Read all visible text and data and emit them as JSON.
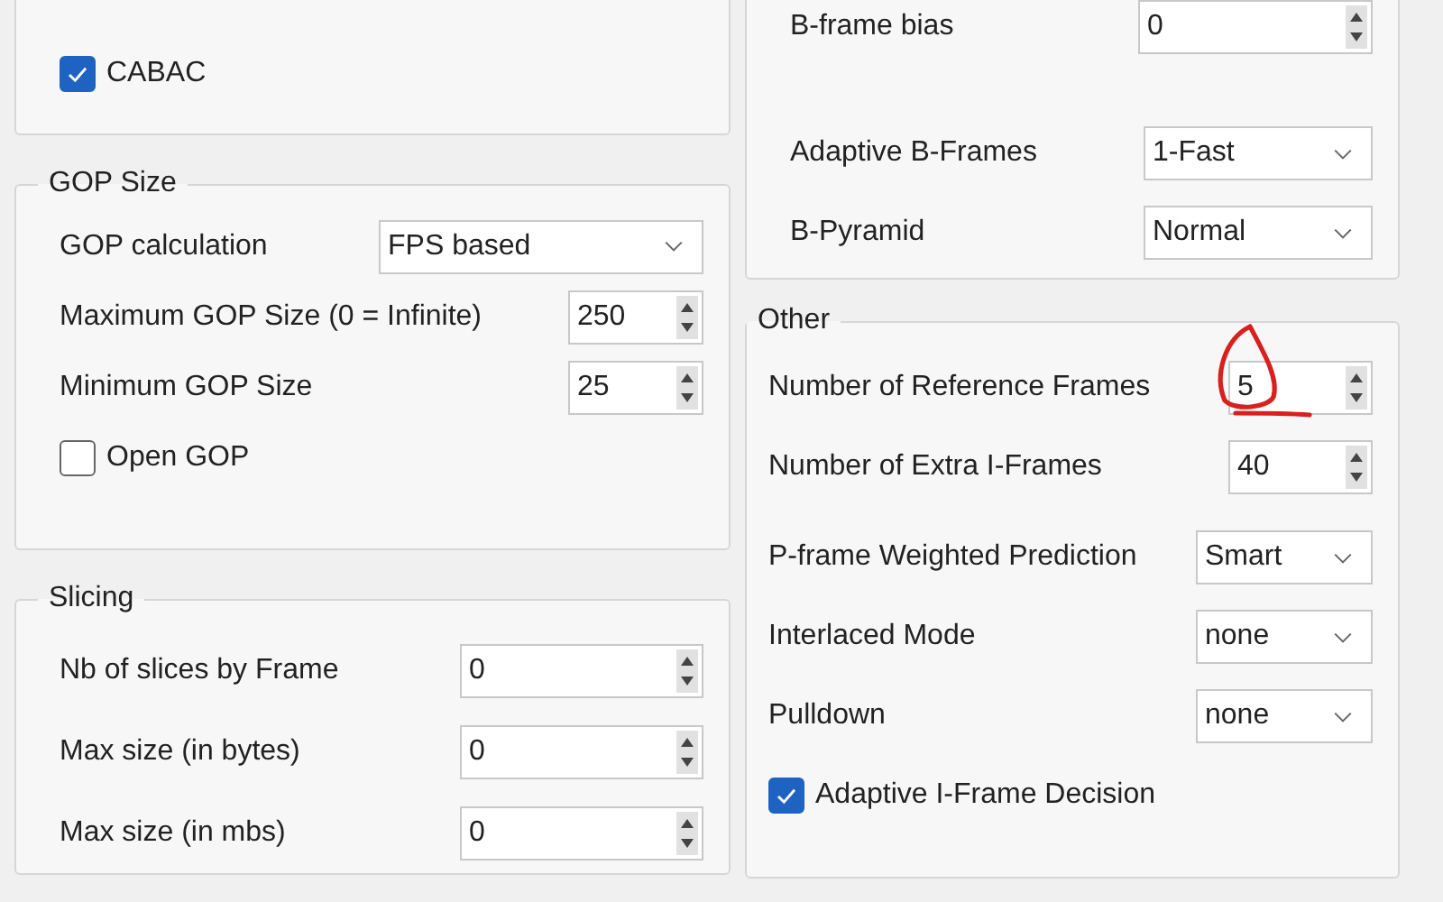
{
  "left_groups": [
    {
      "rows": [
        {
          "kind": "check",
          "label": "CABAC",
          "checked": true
        }
      ]
    },
    {
      "title": "GOP Size",
      "rows": [
        {
          "kind": "combo",
          "label": "GOP calculation",
          "value": "FPS based"
        },
        {
          "kind": "spin",
          "label": "Maximum GOP Size (0 = Infinite)",
          "value": "250"
        },
        {
          "kind": "spin",
          "label": "Minimum GOP Size",
          "value": "25"
        },
        {
          "kind": "check",
          "label": "Open GOP",
          "checked": false
        }
      ]
    },
    {
      "title": "Slicing",
      "rows": [
        {
          "kind": "spin",
          "label": "Nb of slices by Frame",
          "value": "0"
        },
        {
          "kind": "spin",
          "label": "Max size (in bytes)",
          "value": "0"
        },
        {
          "kind": "spin",
          "label": "Max size (in mbs)",
          "value": "0"
        }
      ]
    }
  ],
  "right_groups": [
    {
      "rows": [
        {
          "kind": "spin",
          "label": "B-frame bias",
          "value": "0"
        },
        {
          "kind": "combo",
          "label": "Adaptive B-Frames",
          "value": "1-Fast"
        },
        {
          "kind": "combo",
          "label": "B-Pyramid",
          "value": "Normal"
        }
      ]
    },
    {
      "title": "Other",
      "rows": [
        {
          "kind": "spin",
          "label": "Number of Reference Frames",
          "value": "5",
          "annotated": true
        },
        {
          "kind": "spin",
          "label": "Number of Extra I-Frames",
          "value": "40"
        },
        {
          "kind": "combo",
          "label": "P-frame Weighted Prediction",
          "value": "Smart"
        },
        {
          "kind": "combo",
          "label": "Interlaced Mode",
          "value": "none"
        },
        {
          "kind": "combo",
          "label": "Pulldown",
          "value": "none"
        },
        {
          "kind": "check",
          "label": "Adaptive I-Frame Decision",
          "checked": true
        }
      ]
    }
  ]
}
